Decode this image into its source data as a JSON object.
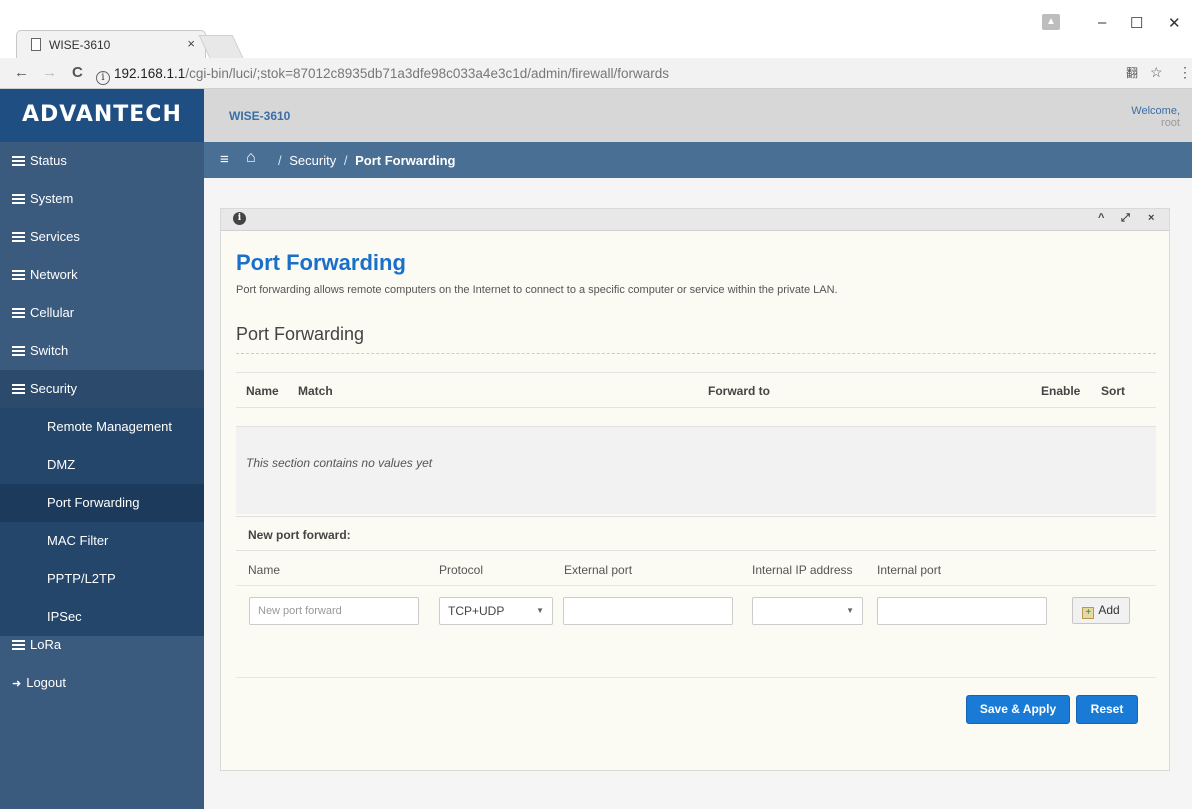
{
  "browser": {
    "tab_title": "WISE-3610",
    "tab_close": "×",
    "url_host": "192.168.1.1",
    "url_path": "/cgi-bin/luci/;stok=87012c8935db71a3dfe98c033a4e3c1d/admin/firewall/forwards",
    "info_icon": "i",
    "back": "←",
    "forward": "→",
    "reload": "C",
    "star": "☆",
    "translate": "翻",
    "menu": "⋮",
    "minimize": "–",
    "maximize": "☐",
    "close": "✕"
  },
  "header": {
    "logo": "ADVANTECH",
    "device_name": "WISE-3610",
    "welcome": "Welcome,",
    "user": "root"
  },
  "breadcrumb": {
    "menu_icon": "≡",
    "home_icon": "⌂",
    "sep1": "/",
    "section": "Security",
    "sep2": "/",
    "current": "Port Forwarding"
  },
  "sidebar": {
    "items": [
      {
        "label": "Status"
      },
      {
        "label": "System"
      },
      {
        "label": "Services"
      },
      {
        "label": "Network"
      },
      {
        "label": "Cellular"
      },
      {
        "label": "Switch"
      },
      {
        "label": "Security"
      }
    ],
    "subitems": [
      {
        "label": "Remote Management"
      },
      {
        "label": "DMZ"
      },
      {
        "label": "Port Forwarding"
      },
      {
        "label": "MAC Filter"
      },
      {
        "label": "PPTP/L2TP"
      },
      {
        "label": "IPSec"
      }
    ],
    "lora": "LoRa",
    "logout": "Logout"
  },
  "panel": {
    "info_icon": "i",
    "collapse_icon": "^",
    "expand_icon": "⤢",
    "close_icon": "×"
  },
  "main": {
    "title": "Port Forwarding",
    "description": "Port forwarding allows remote computers on the Internet to connect to a specific computer or service within the private LAN.",
    "section_title": "Port Forwarding",
    "table_headers": {
      "name": "Name",
      "match": "Match",
      "forward_to": "Forward to",
      "enable": "Enable",
      "sort": "Sort"
    },
    "empty_text": "This section contains no values yet",
    "new_port_forward": {
      "title": "New port forward:",
      "columns": {
        "name": "Name",
        "protocol": "Protocol",
        "external_port": "External port",
        "internal_ip": "Internal IP address",
        "internal_port": "Internal port"
      },
      "name_placeholder": "New port forward",
      "protocol_value": "TCP+UDP",
      "external_port_value": "",
      "internal_ip_value": "",
      "internal_port_value": "",
      "add_label": "Add"
    },
    "save_apply_label": "Save & Apply",
    "reset_label": "Reset"
  },
  "colors": {
    "sidebar": "#3a5a7e",
    "brand": "#1e4e82",
    "accent": "#1a6fc9",
    "button": "#1a7bd6"
  }
}
